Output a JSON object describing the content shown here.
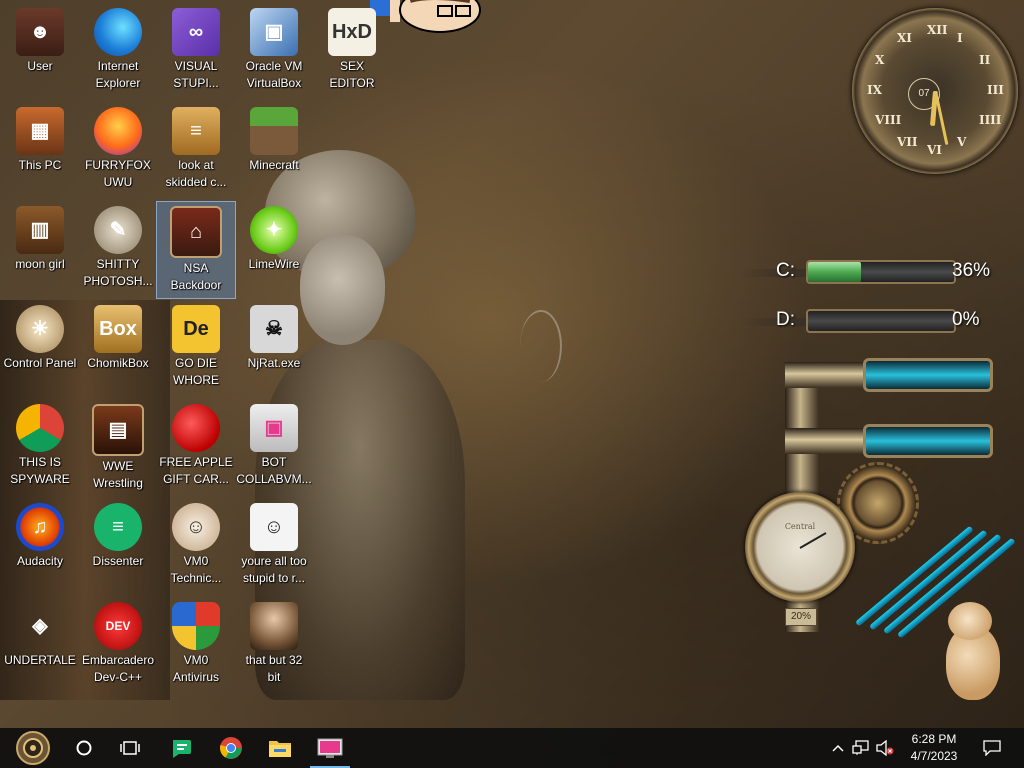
{
  "desktop": {
    "icons": [
      {
        "label": "User",
        "icon": "user-folder-icon"
      },
      {
        "label": "Internet\nExplorer",
        "icon": "edge-icon"
      },
      {
        "label": "VISUAL\nSTUPI...",
        "icon": "visual-studio-icon"
      },
      {
        "label": "Oracle VM\nVirtualBox",
        "icon": "virtualbox-icon"
      },
      {
        "label": "SEX\nEDITOR",
        "icon": "hex-editor-icon"
      },
      {
        "label": "This PC",
        "icon": "computer-icon"
      },
      {
        "label": "FURRYFOX\nUWU",
        "icon": "firefox-icon"
      },
      {
        "label": "look at\nskidded c...",
        "icon": "document-icon"
      },
      {
        "label": "Minecraft",
        "icon": "minecraft-icon"
      },
      {
        "label": "moon girl",
        "icon": "book-icon"
      },
      {
        "label": "SHITTY\nPHOTOSH...",
        "icon": "gimp-icon"
      },
      {
        "label": "NSA\nBackdoor",
        "icon": "backdoor-icon"
      },
      {
        "label": "LimeWire",
        "icon": "limewire-icon"
      },
      {
        "label": "Control Panel",
        "icon": "control-panel-icon"
      },
      {
        "label": "ChomikBox",
        "icon": "chomikbox-icon"
      },
      {
        "label": "GO DIE\nWHORE",
        "icon": "go-die-icon"
      },
      {
        "label": "NjRat.exe",
        "icon": "skull-icon"
      },
      {
        "label": "THIS IS\nSPYWARE",
        "icon": "chrome-icon"
      },
      {
        "label": "WWE\nWrestling",
        "icon": "wwe-icon"
      },
      {
        "label": "FREE APPLE\nGIFT CAR...",
        "icon": "apple-icon"
      },
      {
        "label": "BOT\nCOLLABVM...",
        "icon": "bot-collabvm-icon"
      },
      {
        "label": "Audacity",
        "icon": "audacity-icon"
      },
      {
        "label": "Dissenter",
        "icon": "dissenter-icon"
      },
      {
        "label": "VM0\nTechnic...",
        "icon": "technician-icon"
      },
      {
        "label": "youre all too\nstupid to r...",
        "icon": "portrait-sketch-icon"
      },
      {
        "label": "UNDERTALE",
        "icon": "unity-icon"
      },
      {
        "label": "Embarcadero\nDev-C++",
        "icon": "devcpp-icon"
      },
      {
        "label": "VM0\nAntivirus",
        "icon": "shield-icon"
      },
      {
        "label": "that but 32\nbit",
        "icon": "portrait-icon"
      }
    ],
    "selected_icon": "NSA Backdoor"
  },
  "widgets": {
    "clock": {
      "numerals": [
        "XII",
        "I",
        "II",
        "III",
        "IIII",
        "V",
        "VI",
        "VII",
        "VIII",
        "IX",
        "X",
        "XI"
      ],
      "subdial": "07"
    },
    "drives": [
      {
        "label": "C:",
        "percent_text": "36%",
        "fill": 0.36
      },
      {
        "label": "D:",
        "percent_text": "0%",
        "fill": 0.0
      }
    ],
    "gauge_label": "20%",
    "gauge_dial_text": "Central"
  },
  "taskbar": {
    "start_icon": "steampunk-start-icon",
    "pinned": [
      "cortana-circle-icon",
      "task-view-icon",
      "dissenter-icon",
      "chrome-icon",
      "file-explorer-icon",
      "collabvm-icon"
    ],
    "tray": {
      "time": "6:28 PM",
      "date": "4/7/2023"
    }
  },
  "colors": {
    "taskbar_bg": "#101010",
    "drive_fill": "#4caa52",
    "tube_blue": "#29c0dc",
    "selection": "#5a8cc8"
  }
}
